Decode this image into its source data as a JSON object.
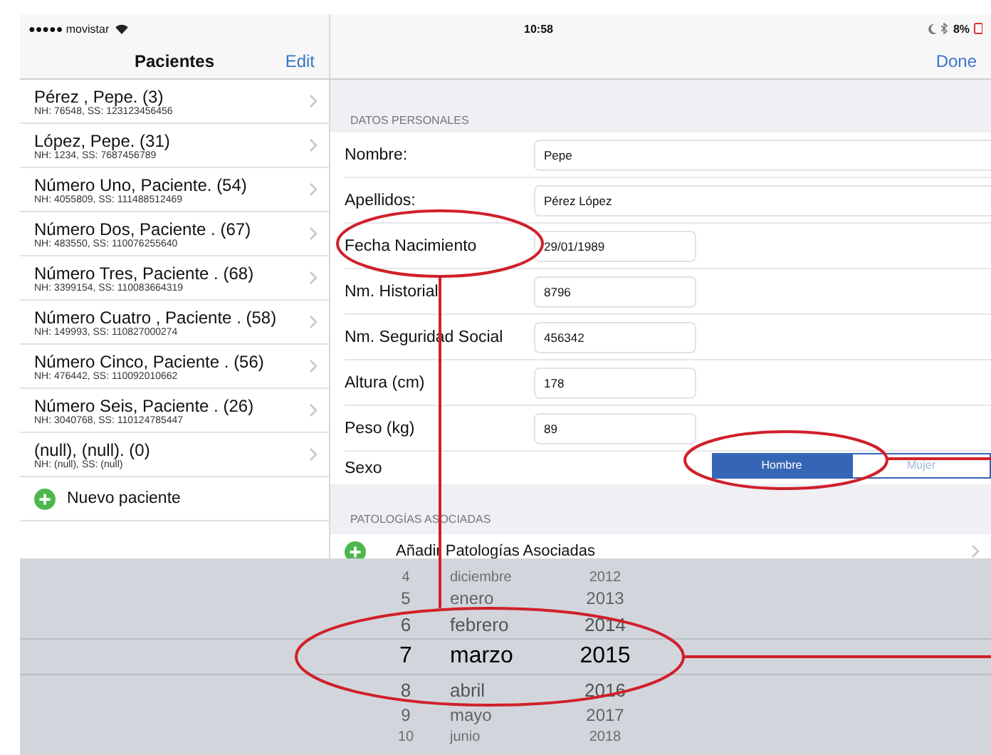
{
  "status_bar": {
    "carrier": "●●●●● movistar",
    "time": "10:58",
    "battery": "8%"
  },
  "master": {
    "title": "Pacientes",
    "edit_button": "Edit",
    "add_button": "Nuevo paciente",
    "patients": [
      {
        "name": "Pérez , Pepe. (3)",
        "detail": "NH: 76548, SS: 123123456456"
      },
      {
        "name": "López, Pepe. (31)",
        "detail": "NH: 1234, SS: 7687456789"
      },
      {
        "name": "Número Uno, Paciente. (54)",
        "detail": "NH: 4055809, SS: 111488512469"
      },
      {
        "name": "Número Dos, Paciente . (67)",
        "detail": "NH: 483550, SS: 110076255640"
      },
      {
        "name": "Número Tres, Paciente . (68)",
        "detail": "NH: 3399154, SS: 110083664319"
      },
      {
        "name": "Número Cuatro , Paciente . (58)",
        "detail": "NH: 149993, SS: 110827000274"
      },
      {
        "name": "Número Cinco, Paciente . (56)",
        "detail": "NH: 476442, SS: 110092010662"
      },
      {
        "name": "Número Seis, Paciente . (26)",
        "detail": "NH: 3040768, SS: 110124785447"
      },
      {
        "name": "(null), (null). (0)",
        "detail": "NH: (null), SS: (null)"
      }
    ]
  },
  "detail": {
    "done_button": "Done",
    "personal_section": "DATOS PERSONALES",
    "fields": [
      {
        "label": "Nombre:",
        "value": "Pepe",
        "kind": "wide"
      },
      {
        "label": "Apellidos:",
        "value": "Pérez López",
        "kind": "wide"
      },
      {
        "label": "Fecha Nacimiento",
        "value": "29/01/1989",
        "kind": "short"
      },
      {
        "label": "Nm. Historial",
        "value": "8796",
        "kind": "short"
      },
      {
        "label": "Nm. Seguridad Social",
        "value": "456342",
        "kind": "short"
      },
      {
        "label": "Altura (cm)",
        "value": "178",
        "kind": "short"
      },
      {
        "label": "Peso (kg)",
        "value": "89",
        "kind": "short"
      }
    ],
    "sex": {
      "label": "Sexo",
      "options": [
        {
          "label": "Hombre",
          "selected": true
        },
        {
          "label": "Mujer",
          "selected": false
        }
      ]
    },
    "pathologies_section": "PATOLOGÍAS ASOCIADAS",
    "add_pathology": "Añadir Patologías Asociadas"
  },
  "picker": {
    "rows": [
      {
        "day": "4",
        "month": "diciembre",
        "year": "2012",
        "selected": false
      },
      {
        "day": "5",
        "month": "enero",
        "year": "2013",
        "selected": false
      },
      {
        "day": "6",
        "month": "febrero",
        "year": "2014",
        "selected": false
      },
      {
        "day": "7",
        "month": "marzo",
        "year": "2015",
        "selected": true
      },
      {
        "day": "8",
        "month": "abril",
        "year": "2016",
        "selected": false
      },
      {
        "day": "9",
        "month": "mayo",
        "year": "2017",
        "selected": false
      },
      {
        "day": "10",
        "month": "junio",
        "year": "2018",
        "selected": false
      }
    ]
  }
}
